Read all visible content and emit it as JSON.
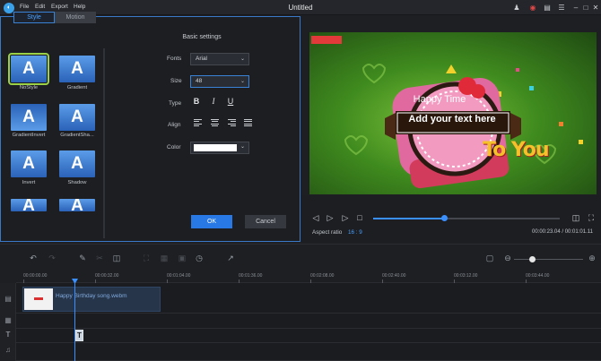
{
  "app": {
    "logo_glyph": "◐",
    "title": "Untitled"
  },
  "menu": [
    "File",
    "Edit",
    "Export",
    "Help"
  ],
  "title_icons": [
    "user-icon",
    "record-icon",
    "gift-icon",
    "list-icon",
    "minimize-icon",
    "maximize-icon",
    "close-icon"
  ],
  "style_panel": {
    "tabs": [
      "Style",
      "Motion"
    ],
    "active_tab": "Style",
    "tiles": [
      {
        "label": "NoStyle",
        "selected": true
      },
      {
        "label": "Gradient"
      },
      {
        "label": "GradientInvert"
      },
      {
        "label": "GradientSha..."
      },
      {
        "label": "Invert"
      },
      {
        "label": "Shadow"
      },
      {
        "label": ""
      },
      {
        "label": ""
      }
    ],
    "tile_glyph": "A"
  },
  "settings": {
    "title": "Basic settings",
    "fonts_label": "Fonts",
    "font_value": "Arial",
    "size_label": "Size",
    "size_value": "48",
    "type_label": "Type",
    "bold": "B",
    "italic": "I",
    "underline": "U",
    "align_label": "Align",
    "color_label": "Color",
    "color_value": "#ffffff",
    "ok": "OK",
    "cancel": "Cancel"
  },
  "preview": {
    "happy_time": "Happy Time",
    "add_text": "Add your text here",
    "to_you": "To You",
    "aspect_label": "Aspect ratio",
    "aspect_value": "16 : 9",
    "timecode": "00:00:23.04 / 00:01:01.11",
    "progress_fraction": 0.38
  },
  "timeline": {
    "ticks": [
      "00:00:00.00",
      "00:00:32.00",
      "00:01:04.00",
      "00:01:36.00",
      "00:02:08.00",
      "00:02:40.00",
      "00:03:12.00",
      "00:03:44.00"
    ],
    "video_clip": "Happy Birthday song.webm",
    "text_clip_glyph": "T",
    "zoom_fraction": 0.25
  },
  "colors": {
    "accent": "#2878e6",
    "selected_tile": "#9bd146",
    "playhead": "#3a90ff"
  }
}
